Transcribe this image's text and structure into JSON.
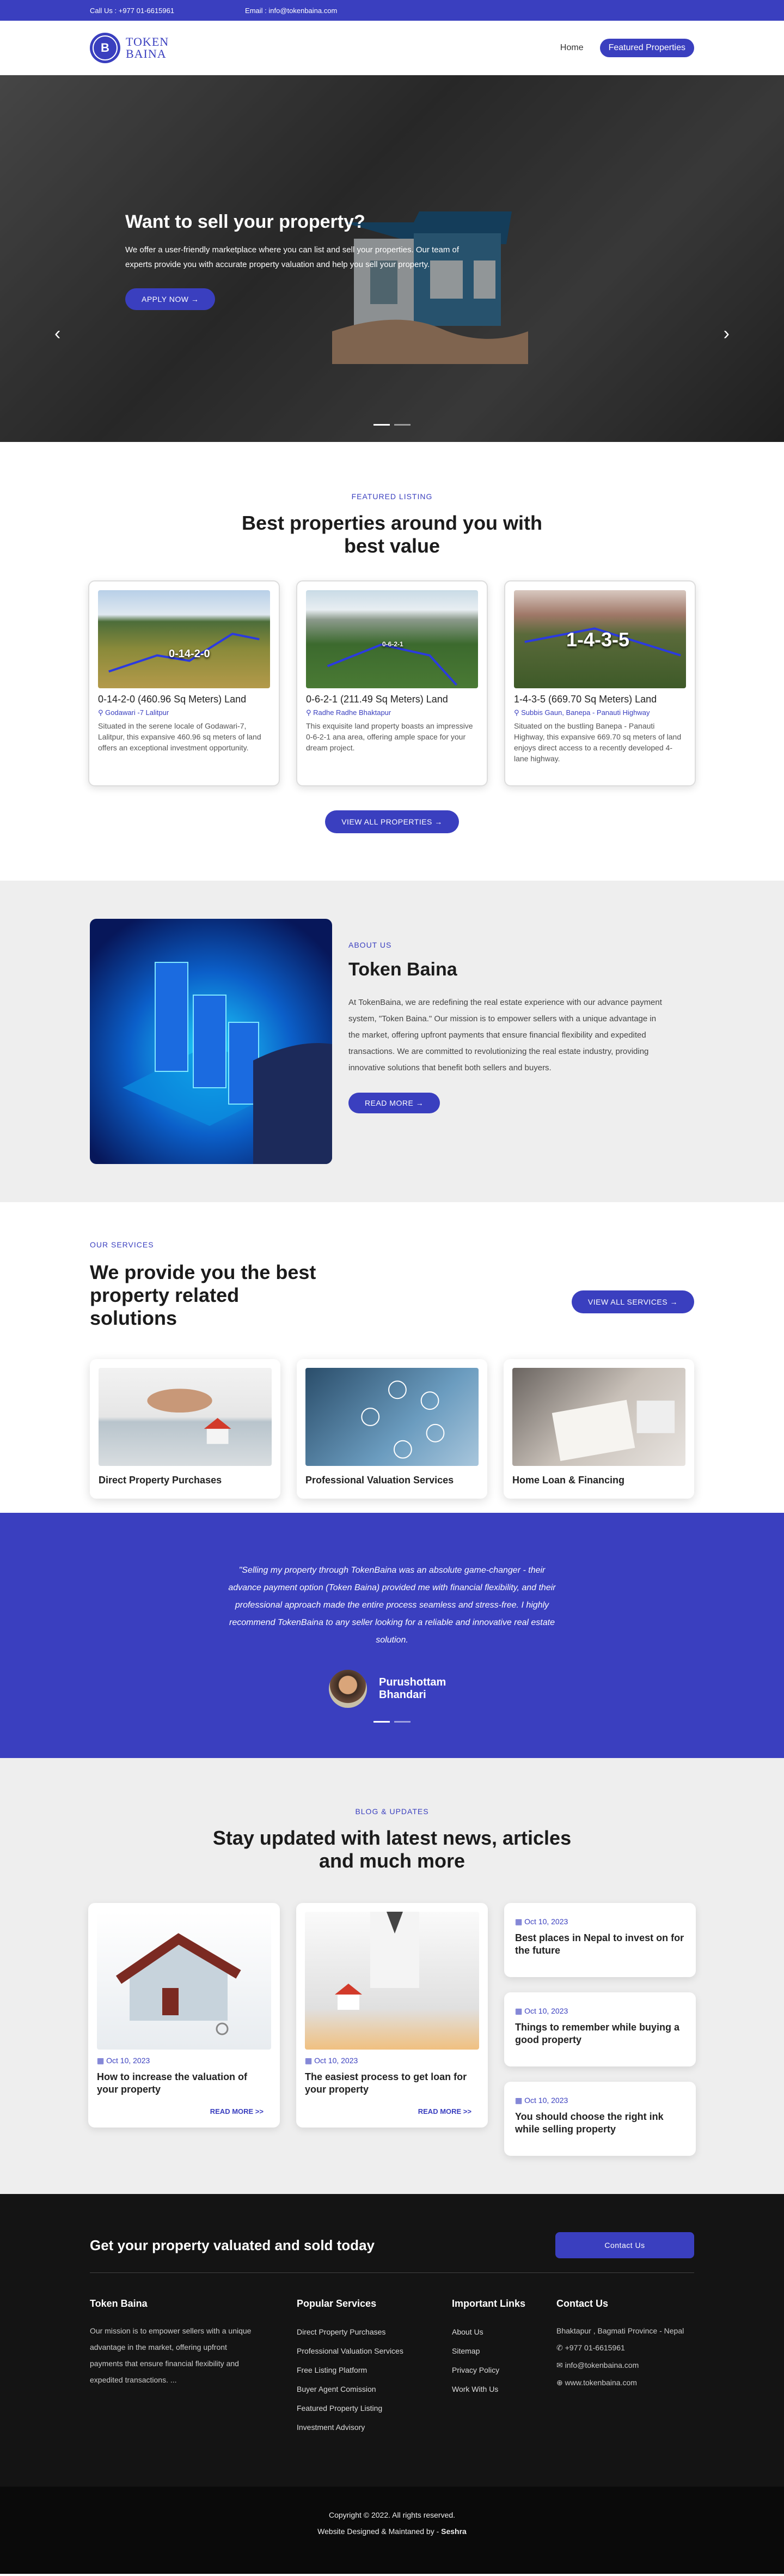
{
  "topbar": {
    "call": "Call Us : +977 01-6615961",
    "email": "Email : info@tokenbaina.com"
  },
  "brand": {
    "line1": "TOKEN",
    "line2": "BAINA",
    "mark": "B"
  },
  "nav": {
    "home": "Home",
    "featured": "Featured Properties"
  },
  "hero": {
    "title": "Want to sell your property?",
    "text": "We offer a user-friendly marketplace where you can list and sell your properties. Our team of experts provide you with accurate property valuation and help you sell your property.",
    "button": "APPLY NOW →",
    "prev": "‹",
    "next": "›"
  },
  "featured": {
    "kicker": "FEATURED LISTING",
    "title": "Best properties around you with best value",
    "cards": [
      {
        "overlay": "0-14-2-0",
        "title": "0-14-2-0 (460.96 Sq Meters) Land",
        "location": "Godawari -7 Lalitpur",
        "desc": "Situated in the serene locale of Godawari-7, Lalitpur, this expansive 460.96 sq meters of land offers an exceptional investment opportunity."
      },
      {
        "overlay": "0-6-2-1",
        "title": "0-6-2-1 (211.49 Sq Meters) Land",
        "location": "Radhe Radhe Bhaktapur",
        "desc": "This exquisite land property boasts an impressive 0-6-2-1 ana area, offering ample space for your dream project."
      },
      {
        "overlay": "1-4-3-5",
        "title": "1-4-3-5 (669.70 Sq Meters) Land",
        "location": "Subbis Gaun, Banepa - Panauti Highway",
        "desc": "Situated on the bustling Banepa - Panauti Highway, this expansive 669.70 sq meters of land enjoys direct access to a recently developed 4-lane highway."
      }
    ],
    "button": "VIEW ALL PROPERTIES →"
  },
  "about": {
    "kicker": "ABOUT US",
    "title": "Token Baina",
    "text": "At TokenBaina, we are redefining the real estate experience with our advance payment system, \"Token Baina.\" Our mission is to empower sellers with a unique advantage in the market, offering upfront payments that ensure financial flexibility and expedited transactions. We are committed to revolutionizing the real estate industry, providing innovative solutions that benefit both sellers and buyers.",
    "button": "READ MORE →"
  },
  "services": {
    "kicker": "OUR SERVICES",
    "title": "We provide you the best property related solutions",
    "button": "VIEW ALL SERVICES →",
    "items": [
      "Direct Property Purchases",
      "Professional Valuation Services",
      "Home Loan & Financing"
    ]
  },
  "testimonial": {
    "quote": "\"Selling my property through TokenBaina was an absolute game-changer - their advance payment option (Token Baina) provided me with financial flexibility, and their professional approach made the entire process seamless and stress-free. I highly recommend TokenBaina to any seller looking for a reliable and innovative real estate solution.",
    "author": "Purushottam Bhandari"
  },
  "blog": {
    "kicker": "BLOG & UPDATES",
    "title": "Stay updated with latest news, articles and much more",
    "posts": [
      {
        "date": "Oct 10, 2023",
        "title": "How to increase the valuation of your property",
        "more": "READ MORE >>"
      },
      {
        "date": "Oct 10, 2023",
        "title": "The easiest process to get loan for your property",
        "more": "READ MORE >>"
      }
    ],
    "side": [
      {
        "date": "Oct 10, 2023",
        "title": "Best places in Nepal to invest on for the future"
      },
      {
        "date": "Oct 10, 2023",
        "title": "Things to remember while buying a good property"
      },
      {
        "date": "Oct 10, 2023",
        "title": "You should choose the right ink while selling property"
      }
    ]
  },
  "footer": {
    "cta": "Get your property valuated and sold today",
    "cta_button": "Contact Us",
    "col1": {
      "title": "Token Baina",
      "text": "Our mission is to empower sellers with a unique advantage in the market, offering upfront payments that ensure financial flexibility and expedited transactions. ..."
    },
    "col2": {
      "title": "Popular Services",
      "items": [
        "Direct Property Purchases",
        "Professional Valuation Services",
        "Free Listing Platform",
        "Buyer Agent Comission",
        "Featured Property Listing",
        "Investment Advisory"
      ]
    },
    "col3": {
      "title": "Important Links",
      "items": [
        "About Us",
        "Sitemap",
        "Privacy Policy",
        "Work With Us"
      ]
    },
    "col4": {
      "title": "Contact Us",
      "address": "Bhaktapur , Bagmati Province - Nepal",
      "phone": "+977 01-6615961",
      "email": "info@tokenbaina.com",
      "web": "www.tokenbaina.com"
    },
    "copyright": "Copyright © 2022. All rights reserved.",
    "credit_prefix": "Website Designed & Maintaned by - ",
    "credit_name": "Seshra"
  },
  "colors": {
    "accent": "#3a3fbf",
    "footer": "#141414"
  }
}
